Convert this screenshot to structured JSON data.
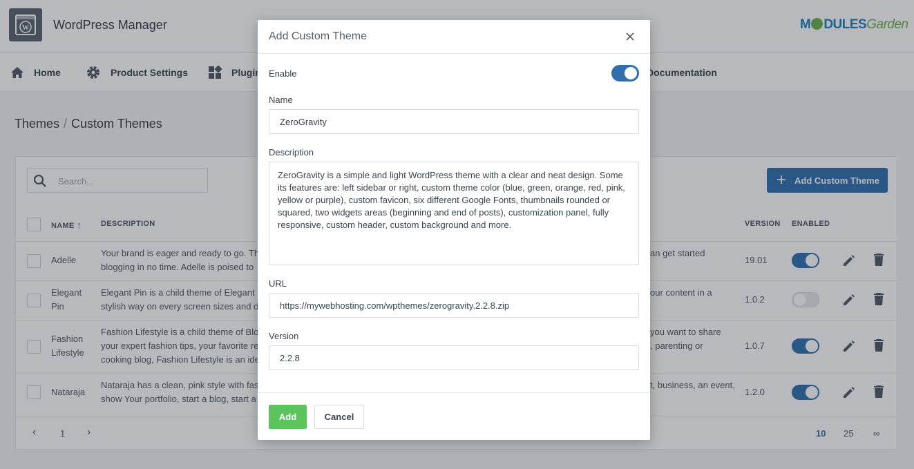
{
  "app": {
    "title": "WordPress Manager",
    "brand_part1": "M",
    "brand_part2": "DULES",
    "brand_part3": "Garden"
  },
  "nav": [
    {
      "label": "Home",
      "icon": "home-icon"
    },
    {
      "label": "Product Settings",
      "icon": "gear-icon"
    },
    {
      "label": "Plugin",
      "icon": "plugin-icon"
    },
    {
      "label": "Documentation",
      "icon": ""
    }
  ],
  "breadcrumb": {
    "parent": "Themes",
    "separator": "/",
    "current": "Custom Themes"
  },
  "toolbar": {
    "search_placeholder": "Search...",
    "add_label": "Add Custom Theme"
  },
  "table": {
    "headers": {
      "name": "NAME",
      "sort_indicator": "↑",
      "description": "DESCRIPTION",
      "version": "VERSION",
      "enabled": "ENABLED"
    },
    "rows": [
      {
        "name": "Adelle",
        "desc_left": "Your brand is eager and ready to go. The",
        "desc_left2": "blogging in no time. Adelle is poised to",
        "desc_right": "an get started",
        "desc_right2": "",
        "version": "19.01",
        "enabled": true
      },
      {
        "name_line1": "Elegant",
        "name_line2": "Pin",
        "desc_left": "Elegant Pin is a child theme of Elegant P",
        "desc_left2": "stylish way on every screen sizes and de",
        "desc_right": "our content in a",
        "desc_right2": "",
        "version": "1.0.2",
        "enabled": false
      },
      {
        "name_line1": "Fashion",
        "name_line2": "Lifestyle",
        "desc_left": "Fashion Lifestyle is a child theme of Blo",
        "desc_left2": "your expert fashion tips, your favorite re",
        "desc_left3": "cooking blog, Fashion Lifestyle is an ide",
        "desc_right": "you want to share",
        "desc_right2": ", parenting or",
        "version": "1.0.7",
        "enabled": true
      },
      {
        "name": "Nataraja",
        "desc_left": "Nataraja has a clean, pink style with fas",
        "desc_left2": "show Your portfolio, start a blog, start a",
        "desc_right": "t, business, an event,",
        "desc_right2": "",
        "version": "1.2.0",
        "enabled": true
      }
    ]
  },
  "pagination": {
    "prev": "‹",
    "page": "1",
    "next": "›",
    "sizes": [
      "10",
      "25",
      "∞"
    ]
  },
  "modal": {
    "title": "Add Custom Theme",
    "close": "×",
    "enable_label": "Enable",
    "enable_value": true,
    "name_label": "Name",
    "name_value": "ZeroGravity",
    "description_label": "Description",
    "description_value": "ZeroGravity is a simple and light WordPress theme with a clear and neat design. Some its features are: left sidebar or right, custom theme color (blue, green, orange, red, pink, yellow or purple), custom favicon, six different Google Fonts, thumbnails rounded or squared, two widgets areas (beginning and end of posts), customization panel, fully responsive, custom header, custom background and more.",
    "url_label": "URL",
    "url_value": "https://mywebhosting.com/wpthemes/zerogravity.2.2.8.zip",
    "version_label": "Version",
    "version_value": "2.2.8",
    "add_button": "Add",
    "cancel_button": "Cancel"
  },
  "colors": {
    "primary": "#2f6fb0",
    "success": "#5cc45c",
    "brand_blue": "#1a7fc1",
    "brand_green": "#6ab04c"
  }
}
